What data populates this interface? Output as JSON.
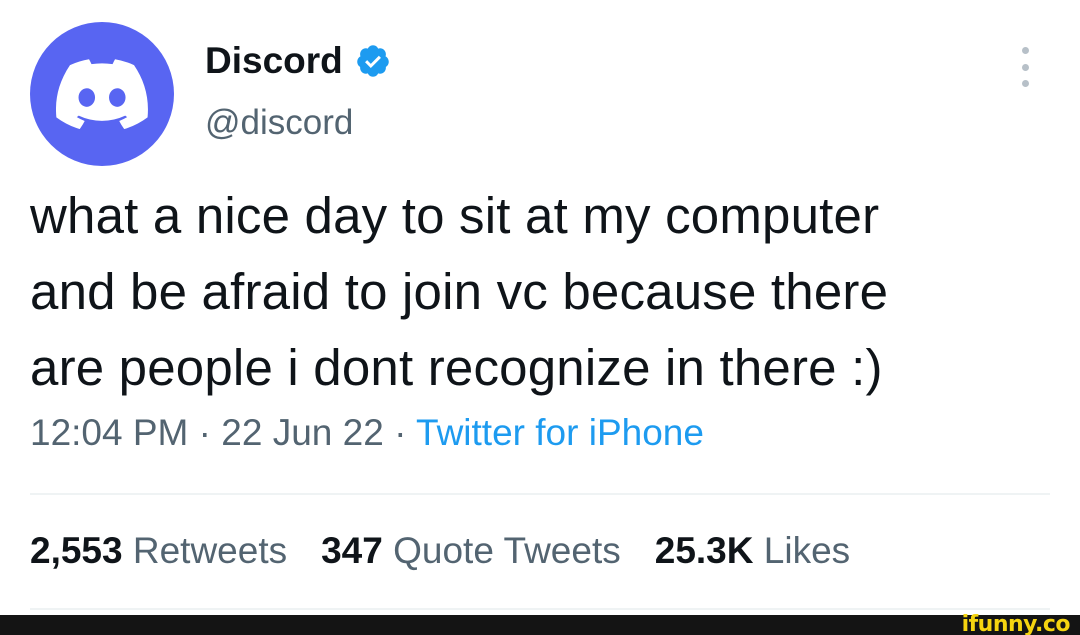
{
  "author": {
    "display_name": "Discord",
    "handle": "@discord",
    "avatar_icon": "discord-logo-icon",
    "avatar_color": "#5865f2",
    "verified_icon": "verified-badge-icon",
    "verified_color": "#1d9bf0"
  },
  "tweet": {
    "text": "what a nice day to sit at my computer\nand be afraid to join vc because there\nare people i dont recognize in there :)",
    "time": "12:04 PM",
    "date": "22 Jun 22",
    "separator": "·",
    "source": "Twitter for iPhone"
  },
  "stats": {
    "retweets_count": "2,553",
    "retweets_label": "Retweets",
    "quotes_count": "347",
    "quotes_label": "Quote Tweets",
    "likes_count": "25.3K",
    "likes_label": "Likes"
  },
  "watermark": {
    "text": "ifunny.co"
  },
  "colors": {
    "text_primary": "#0f1419",
    "text_secondary": "#536471",
    "link": "#1d9bf0"
  }
}
